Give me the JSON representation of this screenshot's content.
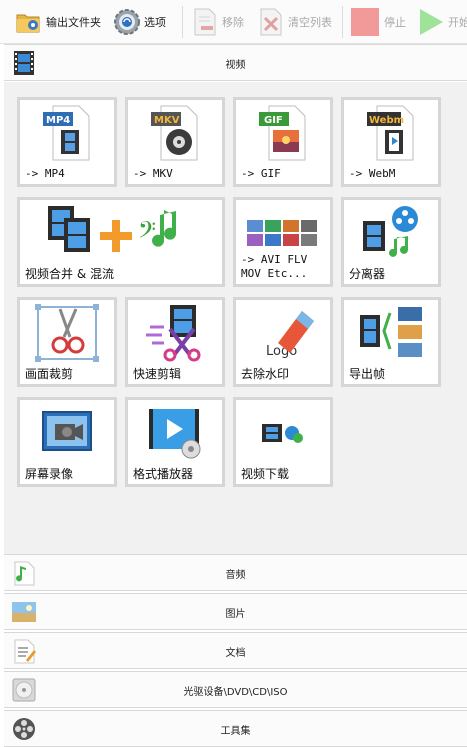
{
  "toolbar": {
    "output_folder": "输出文件夹",
    "options": "选项",
    "remove": "移除",
    "clear_list": "清空列表",
    "stop": "停止",
    "start": "开始"
  },
  "video_section": {
    "title": "视频",
    "tiles": [
      {
        "id": "mp4",
        "label": "-> MP4",
        "badge": "MP4",
        "badge_color": "#2f6db5"
      },
      {
        "id": "mkv",
        "label": "-> MKV",
        "badge": "MKV",
        "badge_color": "#555555"
      },
      {
        "id": "gif",
        "label": "-> GIF",
        "badge": "GIF",
        "badge_color": "#3a9a3a"
      },
      {
        "id": "webm",
        "label": "-> WebM",
        "badge": "Webm",
        "badge_color": "#333333"
      },
      {
        "id": "merge",
        "label": "视频合并 & 混流"
      },
      {
        "id": "other",
        "label": "-> AVI FLV\nMOV Etc..."
      },
      {
        "id": "splitter",
        "label": "分离器"
      },
      {
        "id": "crop",
        "label": "画面裁剪"
      },
      {
        "id": "quickcut",
        "label": "快速剪辑"
      },
      {
        "id": "watermark",
        "label": "去除水印",
        "art_text": "Logo"
      },
      {
        "id": "frames",
        "label": "导出帧"
      },
      {
        "id": "recorder",
        "label": "屏幕录像"
      },
      {
        "id": "player",
        "label": "格式播放器"
      },
      {
        "id": "download",
        "label": "视频下载"
      }
    ]
  },
  "sections": {
    "audio": "音频",
    "picture": "图片",
    "document": "文档",
    "rom": "光驱设备\\DVD\\CD\\ISO",
    "tools": "工具集"
  },
  "colors": {
    "stop": "#f29999",
    "start": "#9fe39a",
    "tile_border": "#d6d6d6",
    "panel_bg": "#f1f1f1"
  }
}
